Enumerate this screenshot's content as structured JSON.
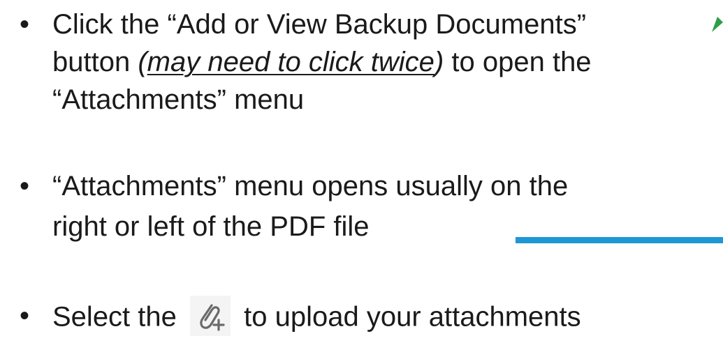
{
  "bullets": [
    {
      "lines": [
        "Click the “Add or View Backup Documents”",
        "button ",
        "may need to click twice",
        " to open the",
        "“Attachments” menu"
      ]
    },
    {
      "lines": [
        "“Attachments” menu opens usually on the",
        "right or left of the PDF file"
      ]
    },
    {
      "before_icon": "Select the ",
      "after_icon": " to upload your attachments",
      "icon": "paperclip-plus-icon"
    }
  ],
  "bullet_char": "•",
  "colors": {
    "text": "#1a1a1a",
    "accent_line": "#1f97d4",
    "arrow": "#2e9e48",
    "icon": "#6a6a6a"
  }
}
